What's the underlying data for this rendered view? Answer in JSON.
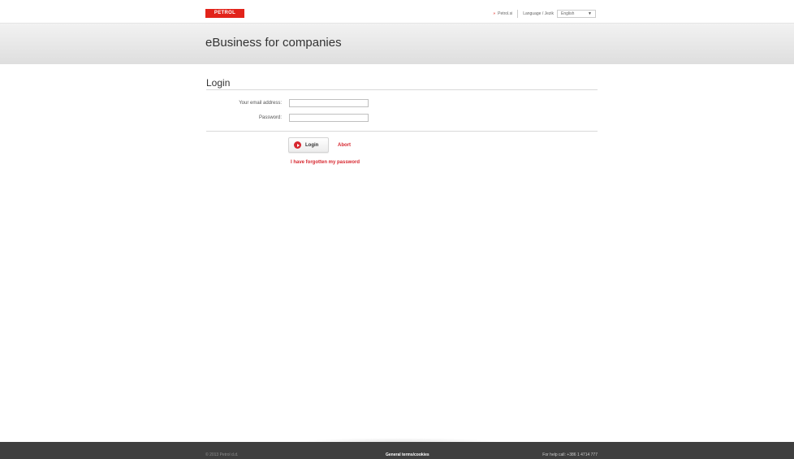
{
  "header": {
    "logo_text": "PETROL",
    "site_link": "Petrol.si",
    "language_label": "Language / Jezik",
    "language_value": "English"
  },
  "banner": {
    "title": "eBusiness for companies"
  },
  "login": {
    "title": "Login",
    "email_label": "Your email address:",
    "email_value": "",
    "password_label": "Password:",
    "password_value": "",
    "login_button": "Login",
    "abort_link": "Abort",
    "forgot_link": "I have forgotten my password"
  },
  "footer": {
    "copyright": "© 2013 Petrol d.d.",
    "terms": "General terms/cookies",
    "help": "For help call: +386 1 4714 777"
  },
  "colors": {
    "accent": "#d7262e",
    "footer_bg": "#3f3f3f",
    "banner_bg": "#e6e6e6"
  }
}
